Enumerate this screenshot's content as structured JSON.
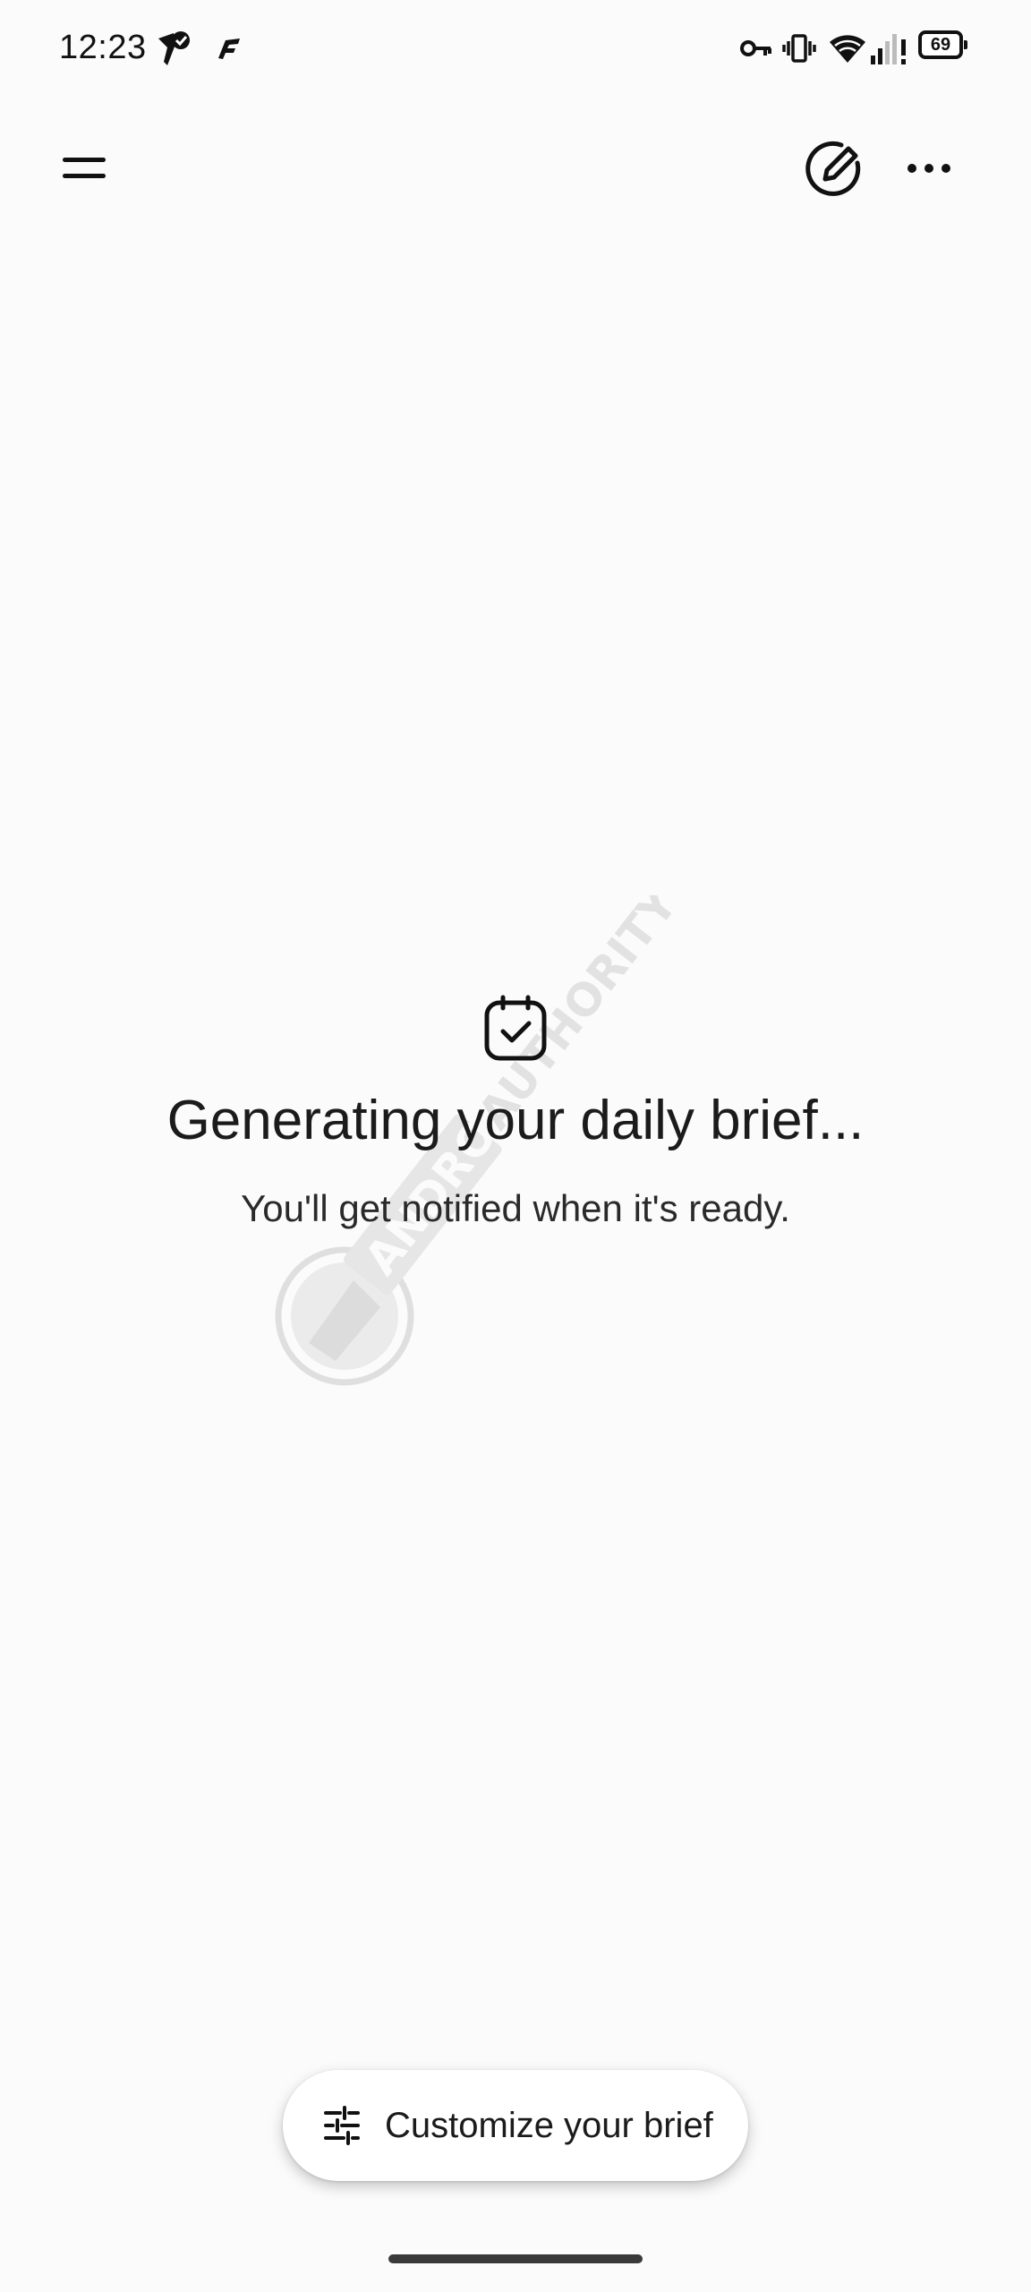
{
  "status_bar": {
    "time": "12:23",
    "battery_level": "69",
    "icons": [
      "notification-check-icon",
      "app-f-icon",
      "vpn-key-icon",
      "vibrate-icon",
      "wifi-icon",
      "signal-icon"
    ]
  },
  "app_bar": {
    "menu_icon": "menu-icon",
    "new_chat_icon": "edit-pen-icon",
    "more_icon": "more-horiz-icon"
  },
  "main": {
    "icon": "calendar-check-icon",
    "headline": "Generating your daily brief...",
    "subtext": "You'll get notified when it's ready."
  },
  "bottom": {
    "customize_label": "Customize your brief",
    "customize_icon": "tune-icon"
  },
  "watermark": {
    "text": "ANDROID AUTHORITY"
  },
  "colors": {
    "background": "#fbfbfb",
    "text": "#1b1b1b",
    "button_bg": "#ffffff"
  }
}
